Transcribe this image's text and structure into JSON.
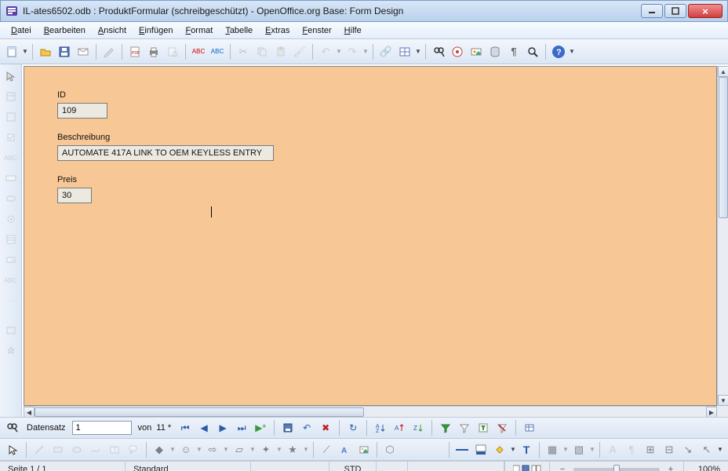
{
  "title": "IL-ates6502.odb : ProduktFormular (schreibgeschützt) - OpenOffice.org Base: Form Design",
  "menu": {
    "items": [
      {
        "accel": "D",
        "rest": "atei"
      },
      {
        "accel": "B",
        "rest": "earbeiten"
      },
      {
        "accel": "A",
        "rest": "nsicht"
      },
      {
        "accel": "E",
        "rest": "infügen"
      },
      {
        "accel": "F",
        "rest": "ormat"
      },
      {
        "accel": "T",
        "rest": "abelle"
      },
      {
        "accel": "E",
        "rest": "xtras"
      },
      {
        "accel": "F",
        "rest": "enster"
      },
      {
        "accel": "H",
        "rest": "ilfe"
      }
    ]
  },
  "form": {
    "fields": [
      {
        "label": "ID",
        "value": "109"
      },
      {
        "label": "Beschreibung",
        "value": "AUTOMATE 417A LINK TO OEM KEYLESS ENTRY"
      },
      {
        "label": "Preis",
        "value": "30"
      }
    ]
  },
  "record": {
    "label": "Datensatz",
    "current": "1",
    "of_label": "von",
    "total": "11 *"
  },
  "status": {
    "page": "Seite 1 / 1",
    "style": "Standard",
    "ovrmode": "STD",
    "zoom": "100%"
  },
  "icons": {
    "new": "▦",
    "open": "📂",
    "save": "💾",
    "mail": "✉",
    "edit": "✎",
    "pdf": "▦",
    "print": "⎙",
    "preview": "🔍",
    "spell": "abc",
    "autospell": "abc",
    "cut": "✂",
    "copy": "▭",
    "paste": "▭",
    "fmtpaint": "🖌",
    "undo": "↶",
    "redo": "↷",
    "link": "🔗",
    "table": "▦",
    "grid": "▦",
    "datasrc": "▤",
    "nonprint": "¶",
    "find": "🔎",
    "nav": "◉",
    "gallery": "▣",
    "dsources": "▥",
    "zoom": "🔍",
    "help": "?",
    "pointer": "↖",
    "line": "—",
    "rect": "▭",
    "ellipse": "◯",
    "first": "|◀",
    "prev": "◀",
    "next": "▶",
    "last": "▶|",
    "new_rec": "▶*",
    "save_rec": "💾",
    "undo_rec": "↶",
    "del": "✖",
    "refresh": "↻",
    "sort": "A↓",
    "sortasc": "A↑",
    "sortdesc": "Z↓",
    "autofilter": "▼",
    "applyfilter": "▽",
    "query": "▤",
    "toggle": "▭"
  }
}
